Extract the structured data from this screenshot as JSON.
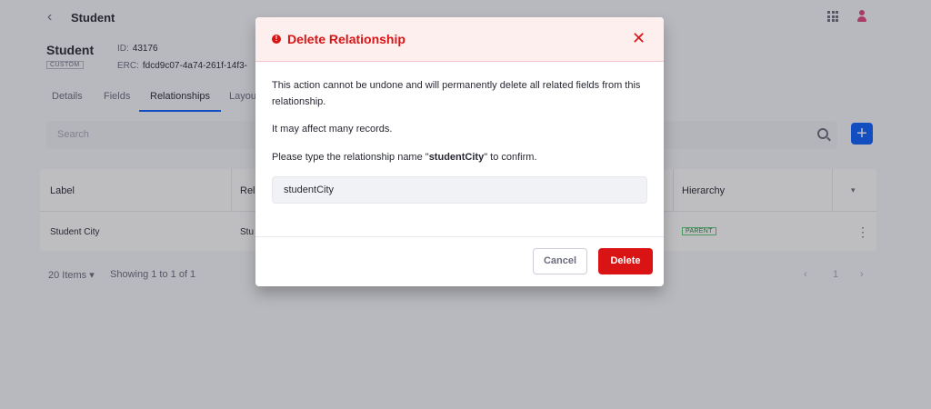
{
  "topbar": {
    "back_icon": "‹",
    "title": "Student",
    "apps_icon": "apps-grid-icon",
    "user_icon": "user-icon"
  },
  "entity": {
    "name": "Student",
    "tag": "CUSTOM",
    "id_label": "ID:",
    "id_value": "43176",
    "erc_label": "ERC:",
    "erc_value": "fdcd9c07-4a74-261f-14f3-"
  },
  "tabs": [
    {
      "label": "Details"
    },
    {
      "label": "Fields"
    },
    {
      "label": "Relationships",
      "active": true
    },
    {
      "label": "Layou"
    }
  ],
  "search": {
    "placeholder": "Search",
    "add_label": "+"
  },
  "table": {
    "headers": [
      "Label",
      "Rel",
      "Hierarchy"
    ],
    "row": {
      "label": "Student City",
      "rel": "Stu",
      "hierarchy": "PARENT",
      "kebab": "⋮"
    },
    "caret": "▾"
  },
  "footer": {
    "items": "20 Items ▾",
    "showing": "Showing 1 to 1 of 1",
    "prev": "‹",
    "page": "1",
    "next": "›"
  },
  "modal": {
    "title": "Delete Relationship",
    "alert_icon": "!",
    "close_icon": "✕",
    "line1": "This action cannot be undone and will permanently delete all related fields from this relationship.",
    "line2": "It may affect many records.",
    "line3_prefix": "Please type the relationship name \"",
    "line3_name": "studentCity",
    "line3_suffix": "\" to confirm.",
    "input_value": "studentCity",
    "cancel_label": "Cancel",
    "delete_label": "Delete"
  },
  "colors": {
    "danger": "#da1414",
    "primary": "#0b5fff",
    "badge": "#287d3c"
  }
}
